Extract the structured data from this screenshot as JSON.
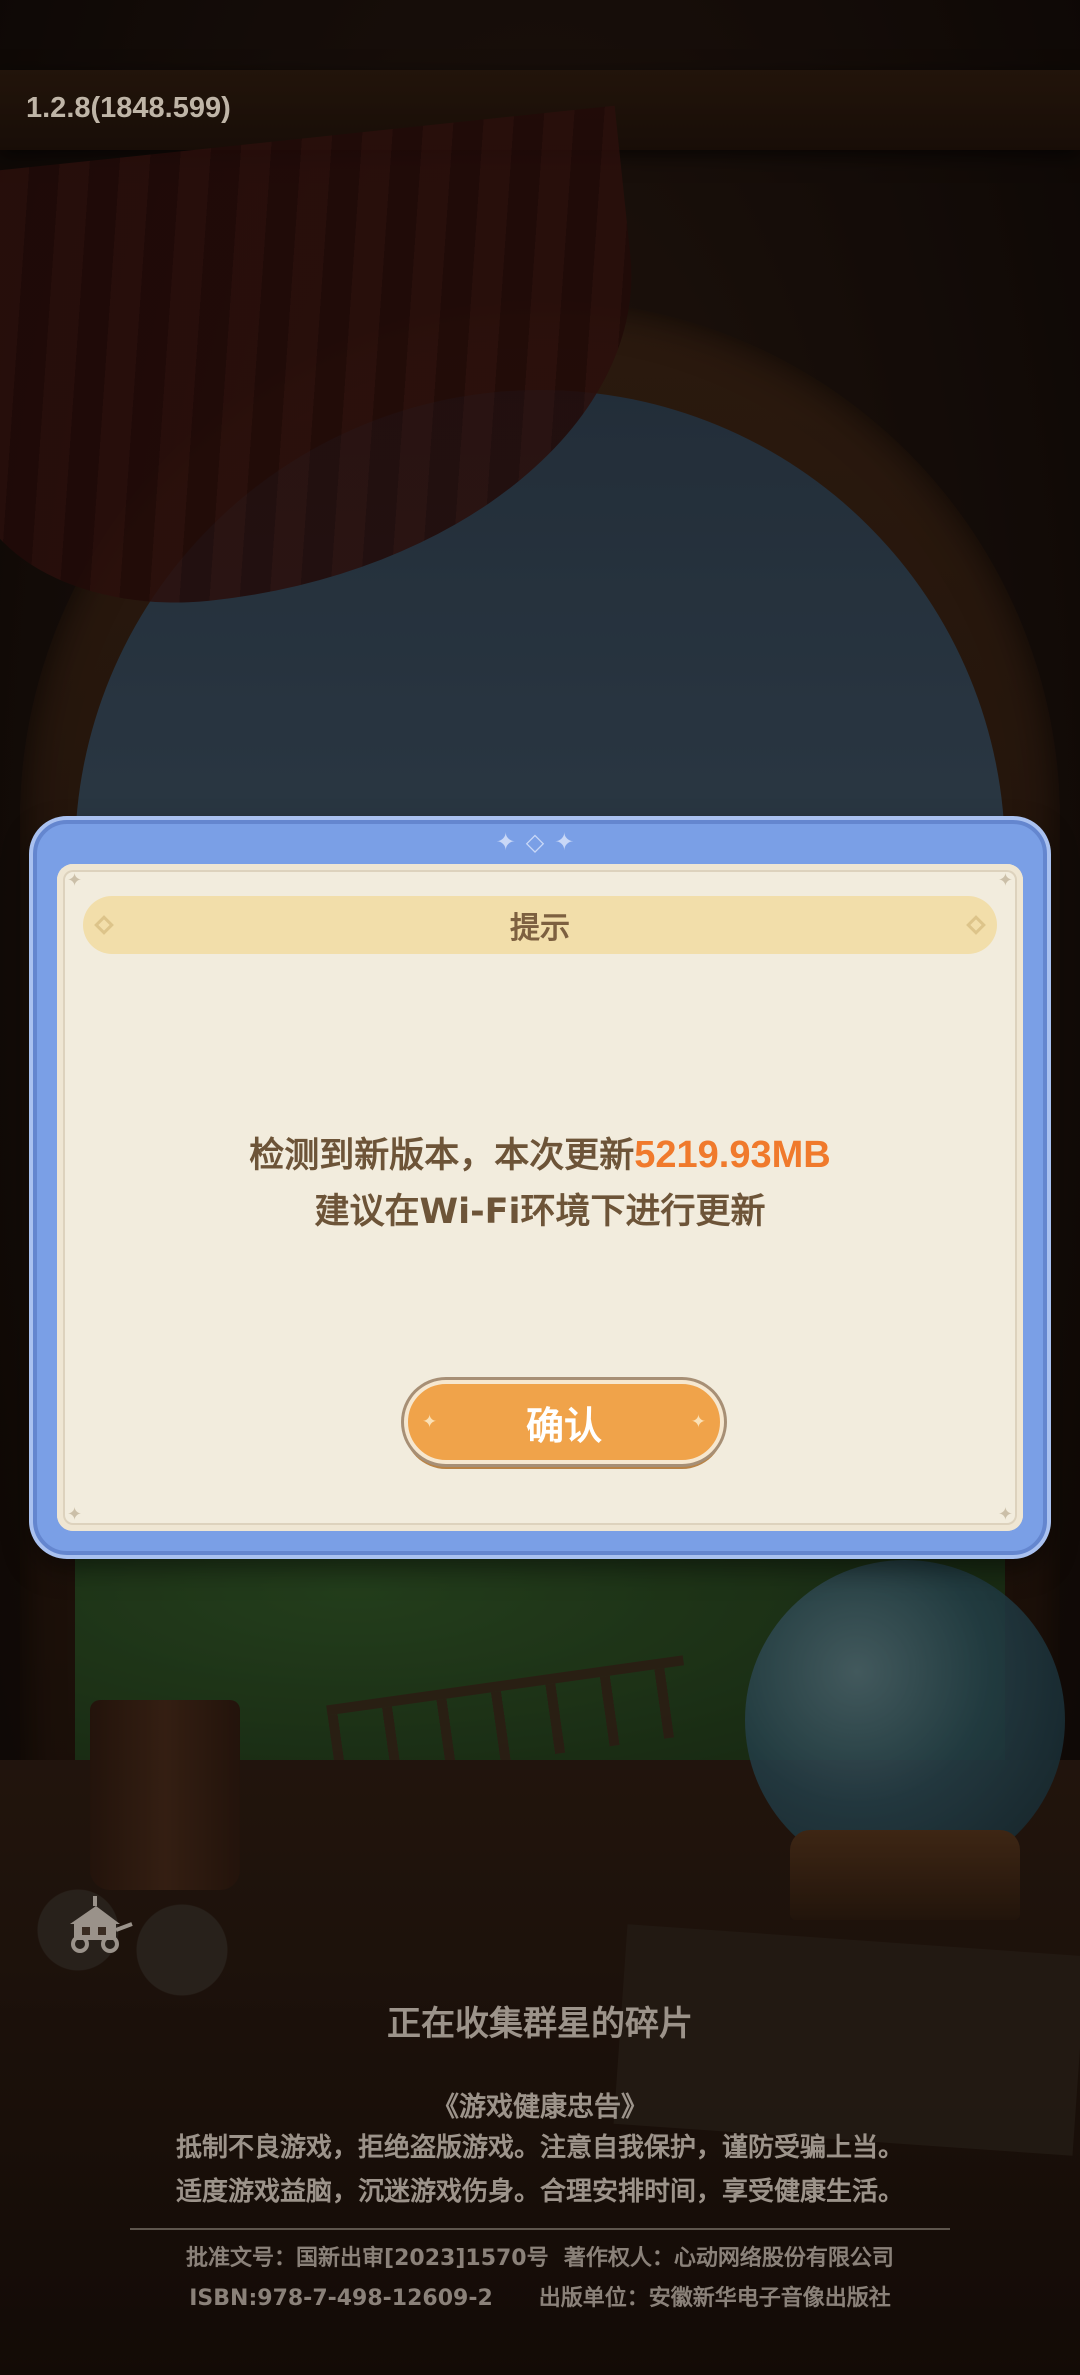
{
  "version": "1.2.8(1848.599)",
  "dialog": {
    "title": "提示",
    "message_prefix": "检测到新版本，本次更新",
    "update_size": "5219.93MB",
    "message_line2": "建议在Wi-Fi环境下进行更新",
    "confirm_label": "确认",
    "colors": {
      "frame": "#7a9fe6",
      "panel": "#f2ecdd",
      "title_bar": "#f2deaa",
      "highlight": "#f07a2c",
      "button": "#f0a34a"
    }
  },
  "loading": {
    "status_text": "正在收集群星的碎片",
    "icon": "cart-icon"
  },
  "health_notice": {
    "title": "《游戏健康忠告》",
    "line1": "抵制不良游戏，拒绝盗版游戏。注意自我保护，谨防受骗上当。",
    "line2": "适度游戏益脑，沉迷游戏伤身。合理安排时间，享受健康生活。"
  },
  "footer": {
    "line1": "批准文号：国新出审[2023]1570号  著作权人：心动网络股份有限公司",
    "line2": "ISBN:978-7-498-12609-2      出版单位：安徽新华电子音像出版社"
  }
}
